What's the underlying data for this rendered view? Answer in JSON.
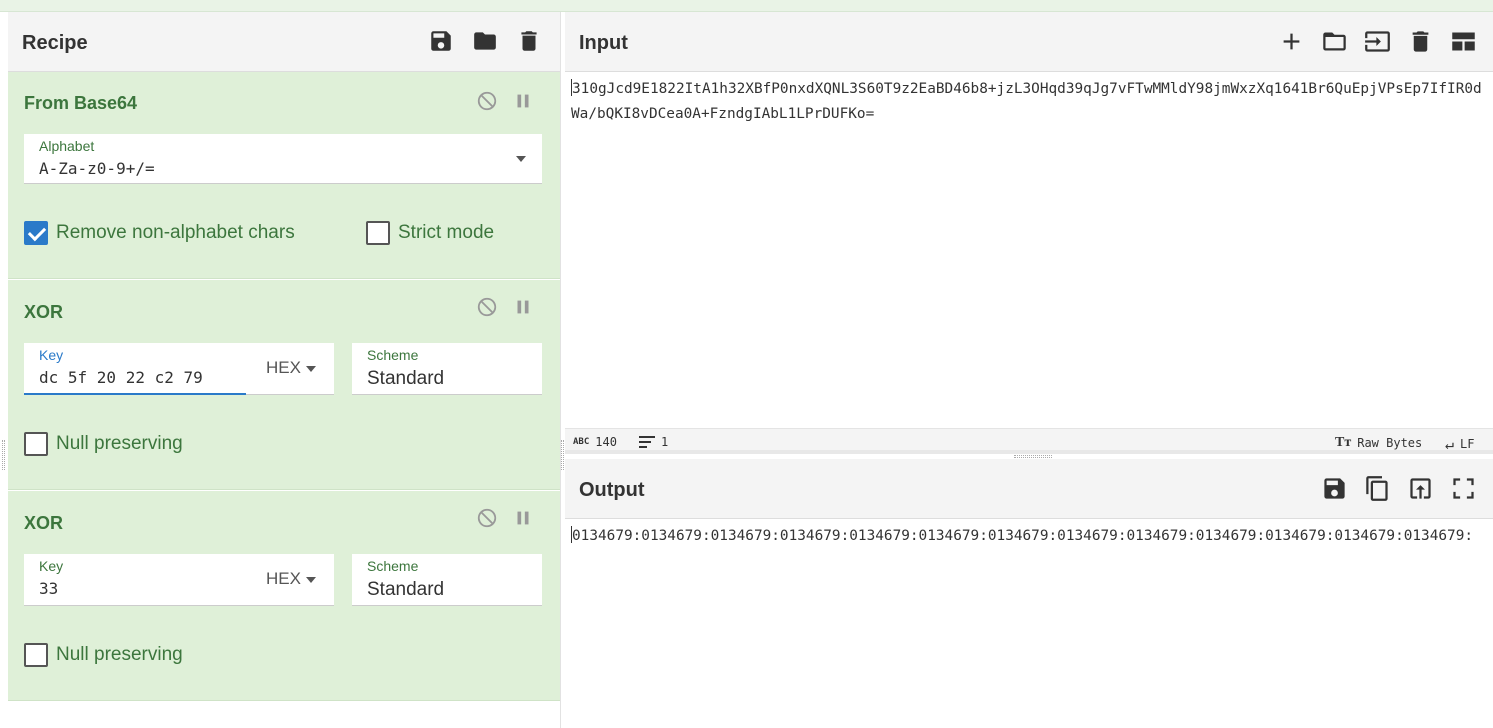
{
  "recipe": {
    "title": "Recipe",
    "operations": [
      {
        "name": "From Base64",
        "alphabet_label": "Alphabet",
        "alphabet_value": "A-Za-z0-9+/=",
        "remove_label": "Remove non-alphabet chars",
        "remove_checked": true,
        "strict_label": "Strict mode",
        "strict_checked": false
      },
      {
        "name": "XOR",
        "key_label": "Key",
        "key_value": "dc 5f 20 22 c2 79",
        "key_format": "HEX",
        "scheme_label": "Scheme",
        "scheme_value": "Standard",
        "null_label": "Null preserving",
        "null_checked": false
      },
      {
        "name": "XOR",
        "key_label": "Key",
        "key_value": "33",
        "key_format": "HEX",
        "scheme_label": "Scheme",
        "scheme_value": "Standard",
        "null_label": "Null preserving",
        "null_checked": false
      }
    ]
  },
  "input": {
    "title": "Input",
    "text": "310gJcd9E1822ItA1h32XBfP0nxdXQNL3S60T9z2EaBD46b8+jzL3OHqd39qJg7vFTwMMldY98jmWxzXq1641Br6QuEpjVPsEp7IfIR0dWa/bQKI8vDCea0A+FzndgIAbL1LPrDUFKo=",
    "length": "140",
    "lines": "1",
    "encoding": "Raw Bytes",
    "eol": "LF"
  },
  "output": {
    "title": "Output",
    "text": "0134679:0134679:0134679:0134679:0134679:0134679:0134679:0134679:0134679:0134679:0134679:0134679:0134679:"
  },
  "colors": {
    "op_bg": "#dff0d8",
    "op_text": "#3c763d",
    "checkbox_blue": "#2a7ac9"
  }
}
